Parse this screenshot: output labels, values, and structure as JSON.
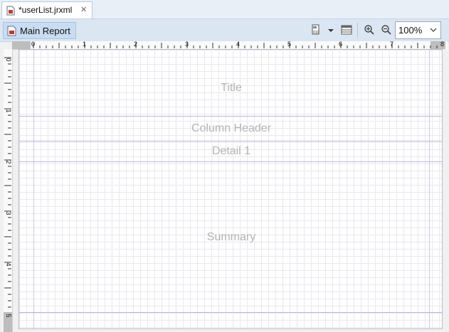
{
  "editor_tab": {
    "title": "*userList.jrxml",
    "close_glyph": "✕"
  },
  "toolbar": {
    "main_report_label": "Main Report",
    "zoom_value": "100%"
  },
  "ruler": {
    "horizontal_numbers": [
      "0",
      "1",
      "2",
      "3",
      "4",
      "5",
      "6",
      "7",
      "8"
    ],
    "vertical_numbers": [
      "0",
      "1",
      "2",
      "3",
      "4",
      "5"
    ]
  },
  "bands": {
    "title": "Title",
    "column_header": "Column Header",
    "detail": "Detail 1",
    "summary": "Summary"
  },
  "icons": {
    "tab": "report-file-icon",
    "main_report": "report-file-icon",
    "data": "data-source-icon",
    "dropdown": "chevron-down-icon",
    "layout": "layout-icon",
    "zoom_in": "zoom-in-icon",
    "zoom_out": "zoom-out-icon"
  },
  "colors": {
    "tab_bar": "#e9eff7",
    "toolbar": "#dbe6f3",
    "band_line": "#b8b8dc",
    "band_label": "#b3b3b3"
  }
}
